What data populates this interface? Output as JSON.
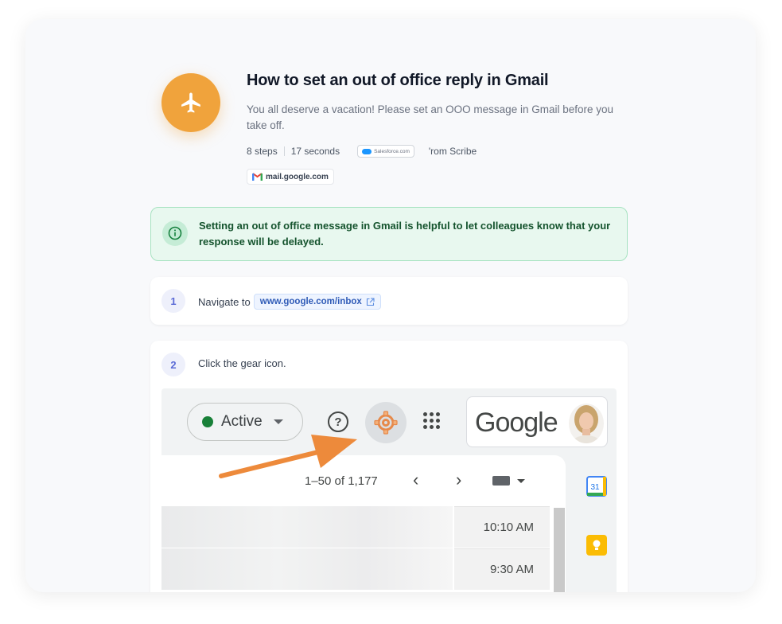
{
  "guide": {
    "title": "How to set an out of office reply in Gmail",
    "description": "You all deserve a vacation! Please set an OOO message in Gmail before you take off.",
    "steps_count": "8 steps",
    "duration": "17 seconds",
    "org_badge": "Salesforce.com",
    "from": "'rom Scribe",
    "domain": "mail.google.com"
  },
  "info": {
    "text": "Setting an out of office message in Gmail is helpful to let colleagues know that your response will be delayed."
  },
  "steps": [
    {
      "number": "1",
      "text": "Navigate to",
      "link": "www.google.com/inbox"
    },
    {
      "number": "2",
      "text": "Click the gear icon."
    }
  ],
  "screenshot": {
    "status": "Active",
    "help": "?",
    "brand": "Google",
    "pager": "1–50 of 1,177",
    "prev": "‹",
    "next": "›",
    "times": [
      "10:10 AM",
      "9:30 AM"
    ],
    "calendar_day": "31"
  },
  "colors": {
    "accent": "#f0a33c",
    "info_bg": "#e8f8ef",
    "link": "#2f5bb7"
  }
}
